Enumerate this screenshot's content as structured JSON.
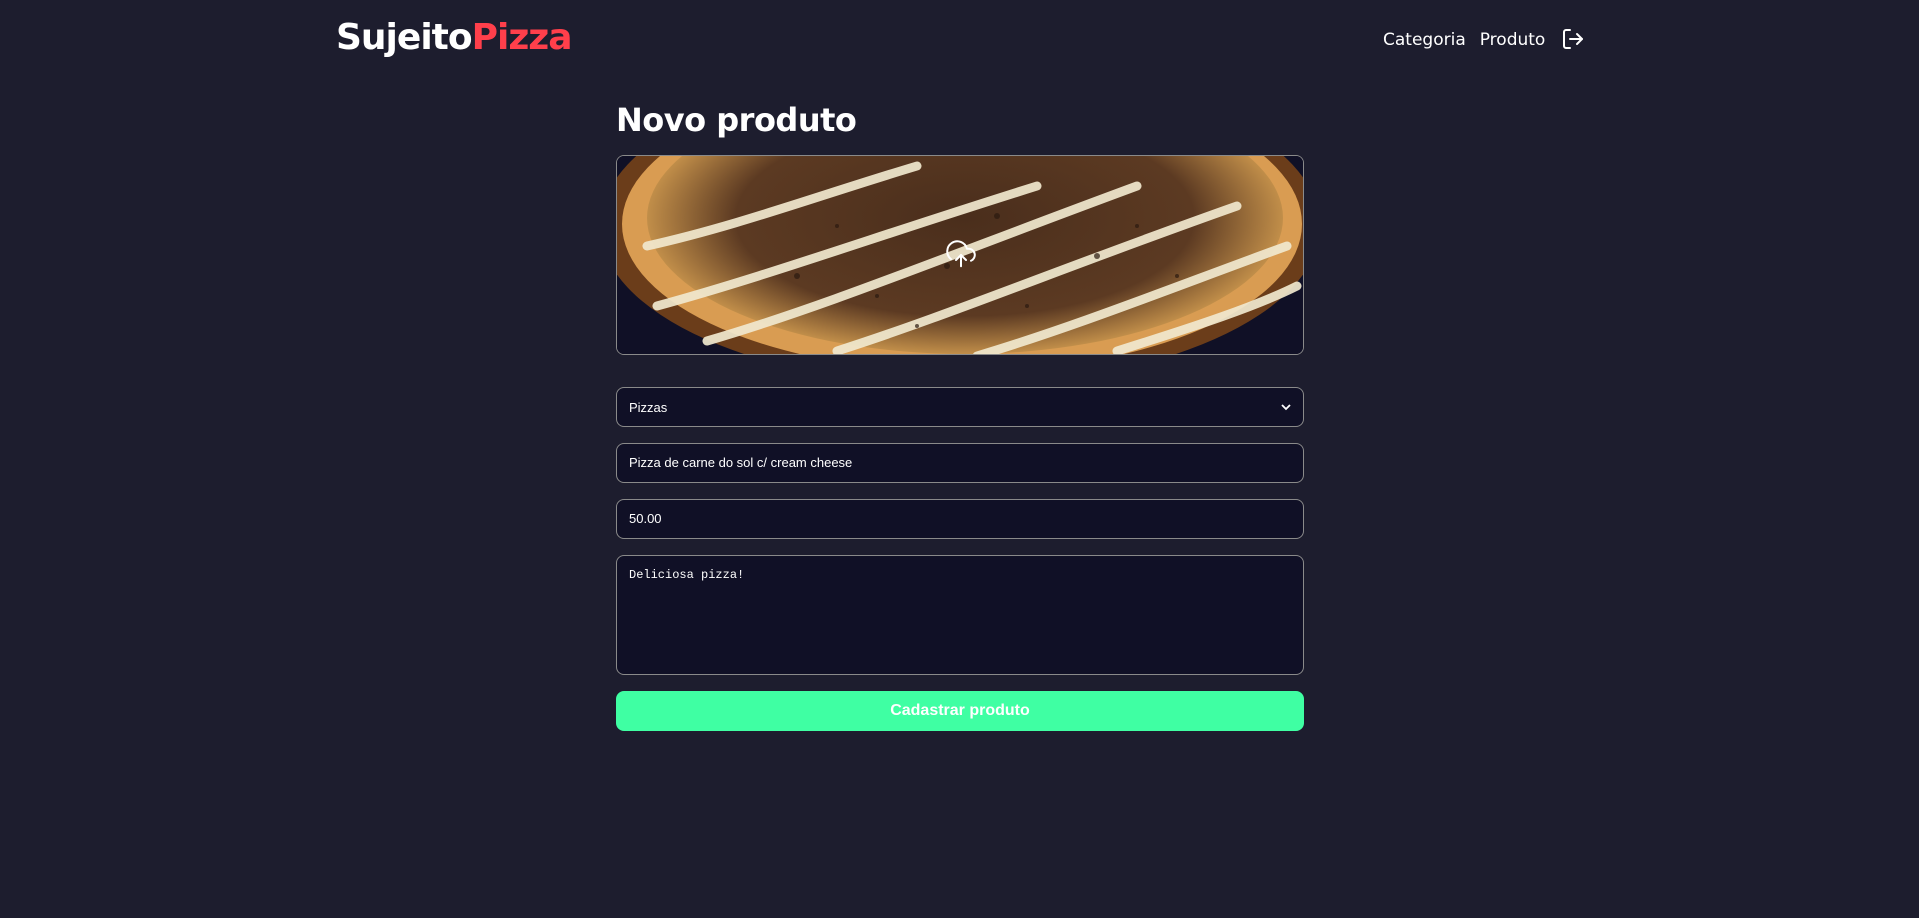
{
  "header": {
    "logo_part1": "Sujeito",
    "logo_part2": "Pizza",
    "nav": [
      {
        "label": "Categoria"
      },
      {
        "label": "Produto"
      }
    ],
    "logout_icon": "logout-icon"
  },
  "page": {
    "title": "Novo produto"
  },
  "form": {
    "image_icon": "upload-cloud-icon",
    "category_selected": "Pizzas",
    "name_value": "Pizza de carne do sol c/ cream cheese",
    "price_value": "50.00",
    "description_value": "Deliciosa pizza!",
    "submit_label": "Cadastrar produto"
  },
  "colors": {
    "background": "#1d1d2e",
    "field_background": "#101026",
    "brand_red": "#ff3f4b",
    "submit_green": "#3fffa3"
  }
}
